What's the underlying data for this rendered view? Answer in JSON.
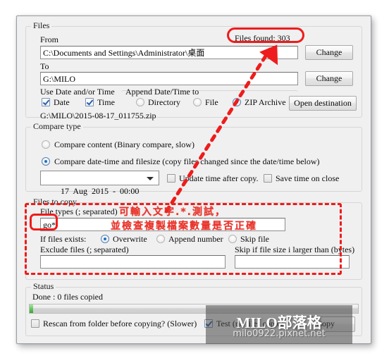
{
  "window": {
    "title": ""
  },
  "files_group": {
    "legend": "Files",
    "from_label": "From",
    "from_value": "C:\\Documents and Settings\\Administrator\\桌面",
    "to_label": "To",
    "to_value": "G:\\MILO",
    "change_from_button": "Change",
    "change_to_button": "Change",
    "open_destination_button": "Open destination",
    "files_found_label": "Files found: 303",
    "use_date_time_label": "Use Date and/or Time",
    "date_checkbox_label": "Date",
    "time_checkbox_label": "Time",
    "append_label": "Append Date/Time to",
    "append_options": [
      "Directory",
      "File",
      "ZIP Archive"
    ],
    "append_selected": "ZIP Archive",
    "result_path": "G:\\MILO\\2015-08-17_011755.zip"
  },
  "compare_group": {
    "legend": "Compare type",
    "option_content": "Compare content (Binary compare, slow)",
    "option_datetime": "Compare date-time and filesize (copy files changed since the date/time below)",
    "selected": "datetime",
    "date_value": "17  Aug  2015  -  00:00",
    "update_time_label": "Update time after copy.",
    "update_time_checked": false,
    "save_time_label": "Save time on close",
    "save_time_checked": false
  },
  "copy_group": {
    "legend": "Files to copy",
    "file_types_label": "File types (; separated)",
    "file_types_value": "go*",
    "file_types_placeholder": "",
    "if_exists_label": "If files exists:",
    "if_exists_options": [
      "Overwrite",
      "Append number",
      "Skip file"
    ],
    "if_exists_selected": "Overwrite",
    "exclude_label": "Exclude files (; separated)",
    "exclude_value": "",
    "skip_size_label": "Skip if file size i larger than (bytes)",
    "skip_size_value": ""
  },
  "status_group": {
    "legend": "Status",
    "status_text": "Done : 0 files copied",
    "progress_percent": 1,
    "rescan_label": "Rescan from folder before copying? (Slower)",
    "rescan_checked": false,
    "test_label": "Test (no files copied)",
    "test_checked": true,
    "copy_button": "Copy"
  },
  "annotations": {
    "note_line1": "可輸入文字.*.測試，",
    "note_line2": "並檢查複製檔案數量是否正確",
    "accent_color": "#ee1c1c"
  },
  "watermark": {
    "line1": "MILO部落格",
    "line2": "milo0922.pixnet.net"
  }
}
